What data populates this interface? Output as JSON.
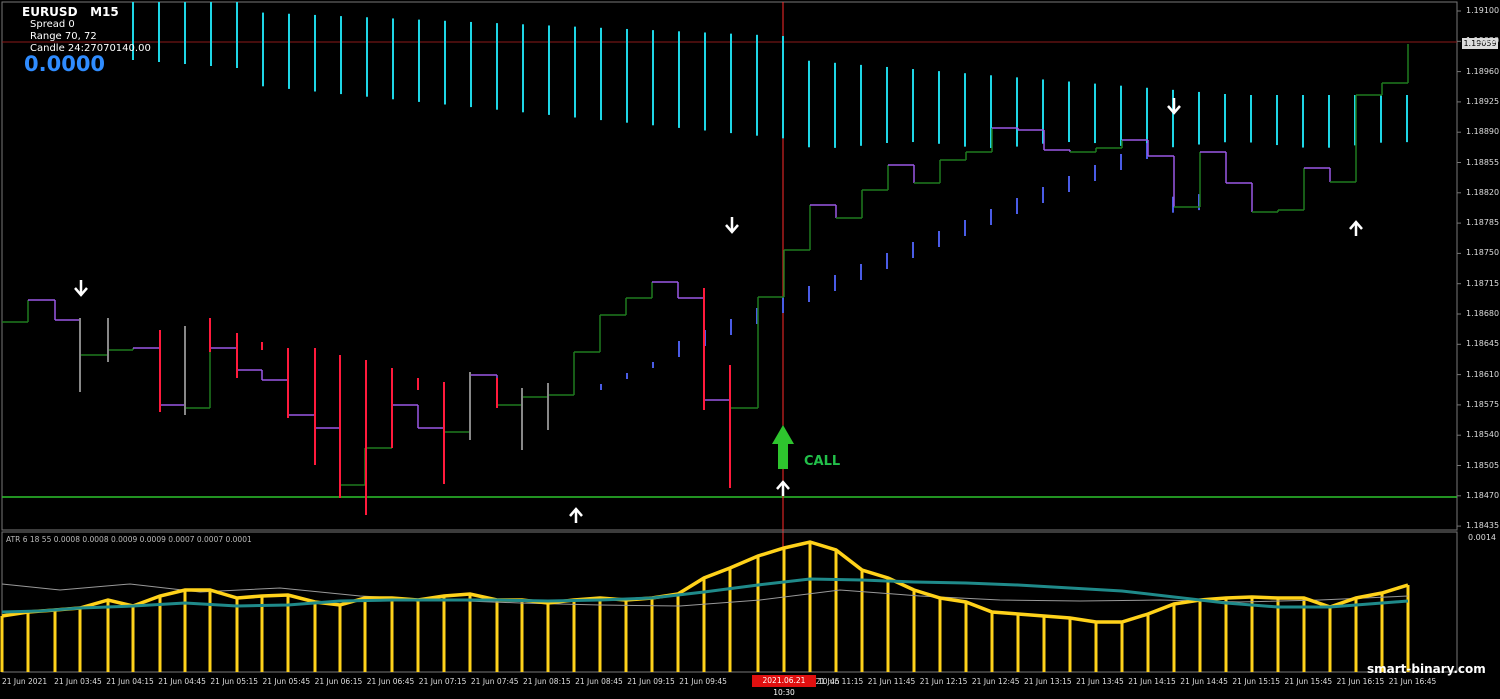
{
  "header": {
    "symbol": "EURUSD",
    "timeframe": "M15",
    "spread": "Spread  0",
    "range": "Range  70, 72",
    "candle": "Candle  24:27070140.00",
    "big_value": "0.0000"
  },
  "price_axis": {
    "labels": [
      "1.19100",
      "1.19030",
      "1.18960",
      "1.18925",
      "1.18890",
      "1.18855",
      "1.18820",
      "1.18785",
      "1.18750",
      "1.18715",
      "1.18680",
      "1.18645",
      "1.18610",
      "1.18575",
      "1.18540",
      "1.18505",
      "1.18470",
      "1.18435"
    ],
    "current_price": "1.19059"
  },
  "time_axis": {
    "labels": [
      "21 Jun 2021",
      "21 Jun 03:45",
      "21 Jun 04:15",
      "21 Jun 04:45",
      "21 Jun 05:15",
      "21 Jun 05:45",
      "21 Jun 06:15",
      "21 Jun 06:45",
      "21 Jun 07:15",
      "21 Jun 07:45",
      "21 Jun 08:15",
      "21 Jun 08:45",
      "21 Jun 09:15",
      "21 Jun 09:45",
      "21 Jun 10:45",
      "21 Jun 11:15",
      "21 Jun 11:45",
      "21 Jun 12:15",
      "21 Jun 12:45",
      "21 Jun 13:15",
      "21 Jun 13:45",
      "21 Jun 14:15",
      "21 Jun 14:45",
      "21 Jun 15:15",
      "21 Jun 15:45",
      "21 Jun 16:15",
      "21 Jun 16:45"
    ],
    "selected": "2021.06.21 10:30"
  },
  "signal": {
    "label": "CALL",
    "color": "#22c04a"
  },
  "atr": {
    "label": "ATR 6 18 55 0.0008 0.0008 0.0009 0.0009 0.0007 0.0007 0.0001",
    "max_label": "0.0014"
  },
  "watermark": "smart-binary.com",
  "colors": {
    "cyan_bars": "#1ed6e6",
    "blue_bars": "#4a5ce6",
    "red_candles": "#ff1a3c",
    "green_step": "#1f7a1f",
    "purple_step": "#9b59e6",
    "support_line": "#2ec42e",
    "resistance_line": "#8b1a1a",
    "atr_yellow": "#ffd21a",
    "atr_teal": "#1f8a8a",
    "vertical_marker": "#ff2a2a"
  },
  "icons": [
    "down-arrow-icon",
    "up-arrow-icon",
    "call-arrow-icon"
  ]
}
